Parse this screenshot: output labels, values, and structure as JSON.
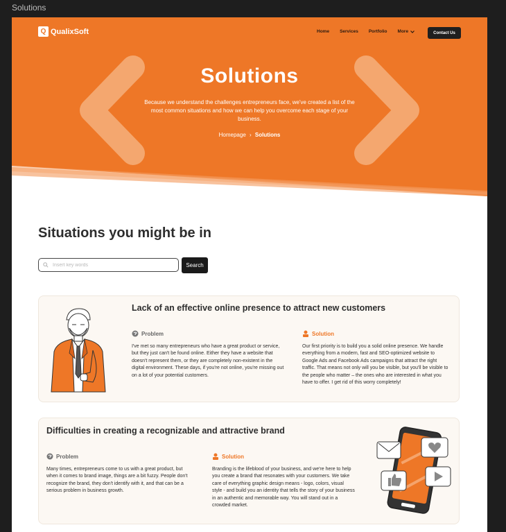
{
  "frame_label": "Solutions",
  "colors": {
    "accent": "#EE7727",
    "dark": "#1f1f1f",
    "card_bg": "#fcf8f3"
  },
  "header": {
    "logo_text": "QualixSoft",
    "logo_icon": "qualixsoft-logo-mark",
    "nav": [
      "Home",
      "Services",
      "Portfolio",
      "More"
    ],
    "contact_label": "Contact Us"
  },
  "hero": {
    "title": "Solutions",
    "text": "Because we understand the challenges entrepreneurs face, we've created a list of the most common situations and how we can help you overcome each stage of your business.",
    "breadcrumb": {
      "home": "Homepage",
      "current": "Solutions"
    }
  },
  "situations": {
    "title": "Situations you might be in",
    "search": {
      "placeholder": "Insert key words",
      "button": "Search"
    },
    "cards": [
      {
        "title": "Lack of an effective online presence to attract new customers",
        "problem_label": "Problem",
        "problem_text": "I've met so many entrepreneurs who have a great product or service, but they just can't be found online. Either they have a website that doesn't represent them, or they are completely non-existent in the digital environment. These days, if you're not online, you're missing out on a lot of your potential customers.",
        "solution_label": "Solution",
        "solution_text": "Our first priority is to build you a solid online presence. We handle everything from a modern, fast and SEO-optimized website to Google Ads and Facebook Ads campaigns that attract the right traffic. That means not only will you be visible, but you'll be visible to the people who matter – the ones who are interested in what you have to offer. I get rid of this worry completely!"
      },
      {
        "title": "Difficulties in creating a recognizable and attractive brand",
        "problem_label": "Problem",
        "problem_text": "Many times, entrepreneurs come to us with a great product, but when it comes to brand image, things are a bit fuzzy. People don't recognize the brand, they don't identify with it, and that can be a serious problem in business growth.",
        "solution_label": "Solution",
        "solution_text": "Branding is the lifeblood of your business, and we're here to help you create a brand that resonates with your customers. We take care of everything graphic design means - logo, colors, visual style - and build you an identity that tells the story of your business in an authentic and memorable way. You will stand out in a crowded market."
      }
    ]
  }
}
